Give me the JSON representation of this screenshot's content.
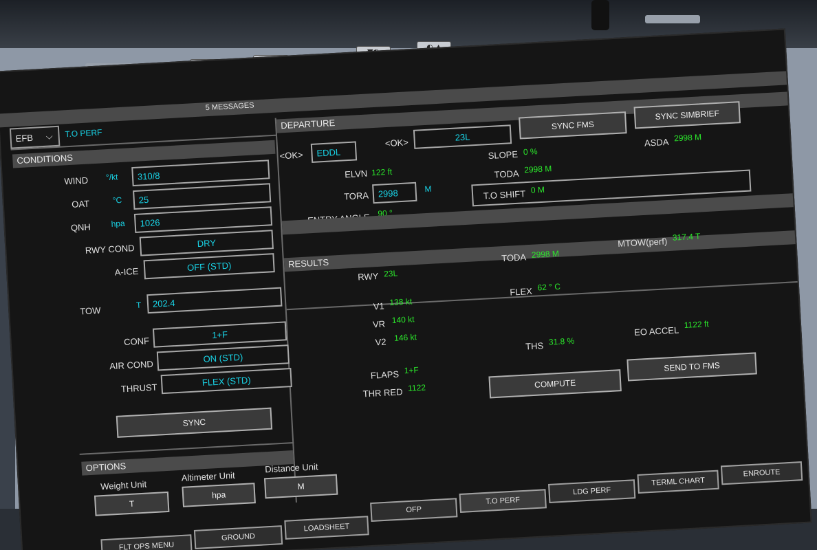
{
  "bezel": {
    "btn1": "▼ ✸",
    "btn2": "✸ ▲",
    "btn3": "▼◐",
    "btn4": "◐ ▲"
  },
  "header": {
    "efb_menu": "EFB",
    "page_title": "T.O PERF",
    "messages": "5 MESSAGES"
  },
  "conditions": {
    "title": "CONDITIONS",
    "wind": {
      "label": "WIND",
      "unit": "°/kt",
      "value": "310/8"
    },
    "oat": {
      "label": "OAT",
      "unit": "°C",
      "value": "25"
    },
    "qnh": {
      "label": "QNH",
      "unit": "hpa",
      "value": "1026"
    },
    "rwy_cond": {
      "label": "RWY COND",
      "value": "DRY"
    },
    "a_ice": {
      "label": "A-ICE",
      "value": "OFF (STD)"
    },
    "tow": {
      "label": "TOW",
      "unit": "T",
      "value": "202.4"
    },
    "conf": {
      "label": "CONF",
      "value": "1+F"
    },
    "air_cond": {
      "label": "AIR COND",
      "value": "ON (STD)"
    },
    "thrust": {
      "label": "THRUST",
      "value": "FLEX (STD)"
    },
    "sync_button": "SYNC"
  },
  "options": {
    "title": "OPTIONS",
    "weight_unit": {
      "label": "Weight Unit",
      "value": "T"
    },
    "altimeter_unit": {
      "label": "Altimeter Unit",
      "value": "hpa"
    },
    "distance_unit": {
      "label": "Distance Unit",
      "value": "M"
    }
  },
  "departure": {
    "title": "DEPARTURE",
    "airport_ok": "<OK>",
    "airport": "EDDL",
    "runway_ok": "<OK>",
    "runway": "23L",
    "sync_fms": "SYNC FMS",
    "sync_simbrief": "SYNC SIMBRIEF",
    "elvn": {
      "label": "ELVN",
      "value": "122 ft"
    },
    "tora": {
      "label": "TORA",
      "value": "2998",
      "unit": "M"
    },
    "entry_angle": {
      "label": "ENTRY ANGLE",
      "value": "90 °"
    },
    "slope": {
      "label": "SLOPE",
      "value": "0 %"
    },
    "toda": {
      "label": "TODA",
      "value": "2998 M"
    },
    "to_shift": {
      "label": "T.O SHIFT",
      "value": "0 M"
    },
    "asda": {
      "label": "ASDA",
      "value": "2998 M"
    }
  },
  "results": {
    "title": "RESULTS",
    "rwy": {
      "label": "RWY",
      "value": "23L"
    },
    "toda": {
      "label": "TODA",
      "value": "2998 M"
    },
    "mtow": {
      "label": "MTOW(perf)",
      "value": "317.4 T"
    },
    "v1": {
      "label": "V1",
      "value": "138 kt"
    },
    "vr": {
      "label": "VR",
      "value": "140 kt"
    },
    "v2": {
      "label": "V2",
      "value": "146 kt"
    },
    "flex": {
      "label": "FLEX",
      "value": "62 ° C"
    },
    "ths": {
      "label": "THS",
      "value": "31.8 %"
    },
    "eo_accel": {
      "label": "EO ACCEL",
      "value": "1122 ft"
    },
    "flaps": {
      "label": "FLAPS",
      "value": "1+F"
    },
    "thr_red": {
      "label": "THR RED",
      "value": "1122"
    },
    "compute": "COMPUTE",
    "send_to_fms": "SEND TO FMS"
  },
  "tabs_upper": [
    "OFP",
    "T.O PERF",
    "LDG PERF",
    "TERML CHART",
    "ENROUTE"
  ],
  "tabs_lower": [
    "FLT OPS MENU",
    "GROUND",
    "LOADSHEET"
  ],
  "colors": {
    "value_cyan": "#19d3e6",
    "value_green": "#2be82b",
    "screen_bg": "#151515"
  }
}
